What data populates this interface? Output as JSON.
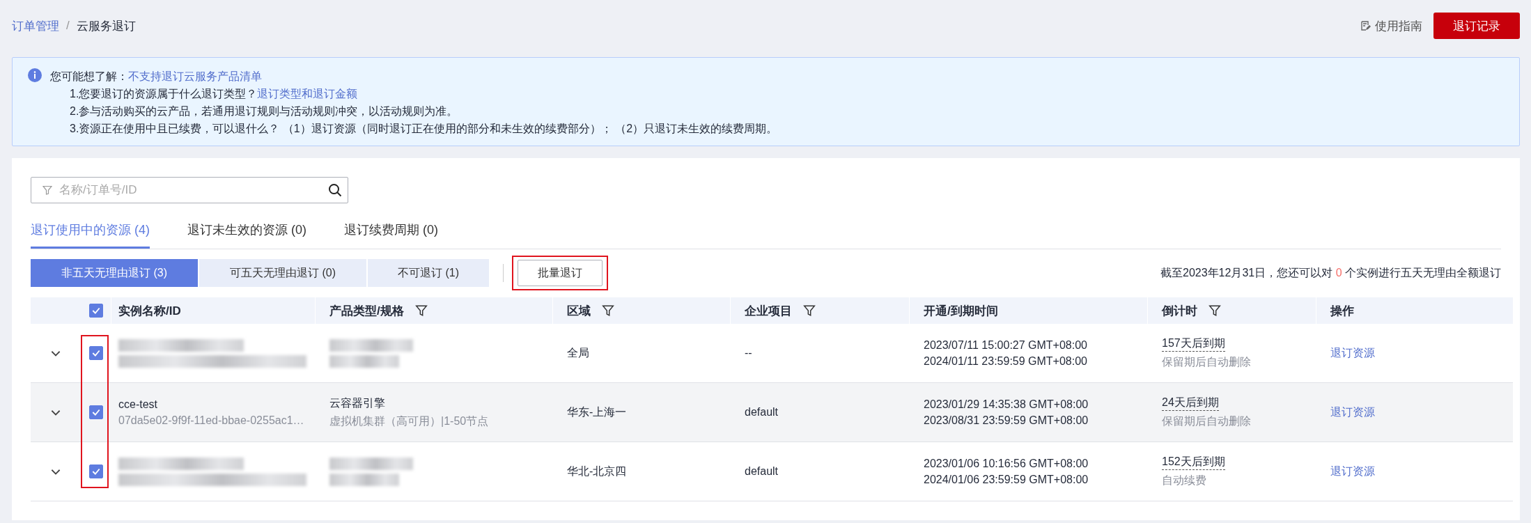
{
  "breadcrumb": [
    {
      "label": "订单管理",
      "kind": "link"
    },
    {
      "label": "云服务退订",
      "kind": "current"
    }
  ],
  "breadcrumb_separator": "/",
  "guide_link": "使用指南",
  "record_button": "退订记录",
  "notice": [
    {
      "text": "您可能想了解：",
      "link": "不支持退订云服务产品清单"
    },
    {
      "text": "1.您要退订的资源属于什么退订类型？",
      "link": "退订类型和退订金额"
    },
    {
      "text": "2.参与活动购买的云产品，若通用退订规则与活动规则冲突，以活动规则为准。"
    },
    {
      "text": "3.资源正在使用中且已续费，可以退什么？ （1）退订资源（同时退订正在使用的部分和未生效的续费部分）；  （2）只退订未生效的续费周期。"
    }
  ],
  "search": {
    "placeholder": "名称/订单号/ID"
  },
  "tabs": [
    {
      "label": "退订使用中的资源 (4)",
      "selected": true
    },
    {
      "label": "退订未生效的资源 (0)",
      "selected": false
    },
    {
      "label": "退订续费周期 (0)",
      "selected": false
    }
  ],
  "segments": [
    {
      "label": "非五天无理由退订 (3)",
      "selected": true
    },
    {
      "label": "可五天无理由退订 (0)",
      "selected": false
    },
    {
      "label": "不可退订 (1)",
      "selected": false
    }
  ],
  "batch_button": {
    "label": "批量退订",
    "highlighted": true
  },
  "quota_note": {
    "before": "截至2023年12月31日，您还可以对",
    "count": "0",
    "after": "个实例进行五天无理由全额退订"
  },
  "table": {
    "all_checked": true,
    "checkboxes_highlighted": true,
    "columns": [
      {
        "label": "实例名称/ID",
        "filter": false
      },
      {
        "label": "产品类型/规格",
        "filter": true
      },
      {
        "label": "区域",
        "filter": true
      },
      {
        "label": "企业项目",
        "filter": true
      },
      {
        "label": "开通/到期时间",
        "filter": false
      },
      {
        "label": "倒计时",
        "filter": true
      },
      {
        "label": "操作",
        "filter": false
      }
    ],
    "rows": [
      {
        "checked": true,
        "masked": true,
        "hovered": false,
        "region": "全局",
        "project": "--",
        "start": "2023/07/11 15:00:27 GMT+08:00",
        "end": "2024/01/11 23:59:59 GMT+08:00",
        "countdown": "157天后到期",
        "policy": "保留期后自动删除",
        "action": "退订资源"
      },
      {
        "checked": true,
        "masked": false,
        "hovered": true,
        "name": "cce-test",
        "id": "07da5e02-9f9f-11ed-bbae-0255ac1…",
        "product": "云容器引擎",
        "spec": "虚拟机集群（高可用）|1-50节点",
        "region": "华东-上海一",
        "project": "default",
        "start": "2023/01/29 14:35:38 GMT+08:00",
        "end": "2023/08/31 23:59:59 GMT+08:00",
        "countdown": "24天后到期",
        "policy": "保留期后自动删除",
        "action": "退订资源"
      },
      {
        "checked": true,
        "masked": true,
        "hovered": false,
        "region": "华北-北京四",
        "project": "default",
        "start": "2023/01/06 10:16:56 GMT+08:00",
        "end": "2024/01/06 23:59:59 GMT+08:00",
        "countdown": "152天后到期",
        "policy": "自动续费",
        "action": "退订资源"
      }
    ]
  }
}
